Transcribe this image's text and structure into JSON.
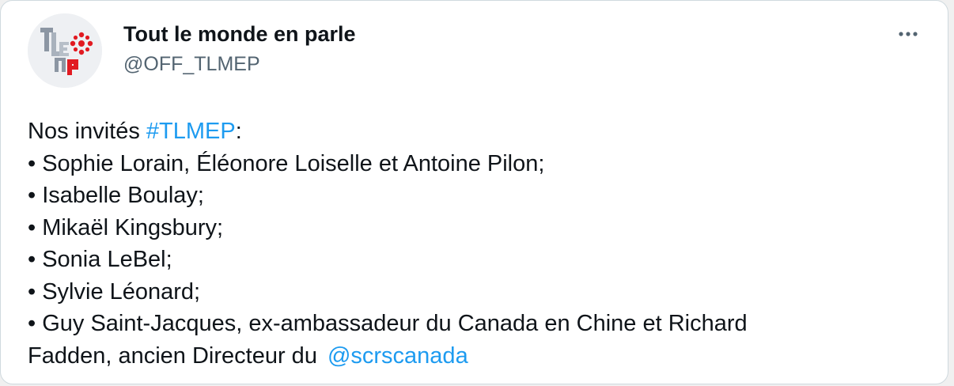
{
  "author": {
    "display_name": "Tout le monde en parle",
    "handle": "@OFF_TLMEP",
    "avatar_logo_text": "TLMEP",
    "avatar_icon": "radio-canada-gem-icon"
  },
  "menu": {
    "icon": "more-horizontal-icon"
  },
  "tweet": {
    "intro_text": "Nos invités ",
    "hashtag": "#TLMEP",
    "intro_suffix": ":",
    "guests": [
      "• Sophie Lorain, Éléonore Loiselle et Antoine Pilon;",
      "• Isabelle Boulay;",
      "• Mikaël Kingsbury;",
      "• Sonia LeBel;",
      "• Sylvie Léonard;",
      "• Guy Saint-Jacques, ex-ambassadeur du Canada en Chine et Richard"
    ],
    "last_line_text": "Fadden, ancien Directeur du",
    "mention": "@scrscanada"
  },
  "colors": {
    "link": "#1d9bf0",
    "text": "#0f1419",
    "secondary_text": "#536471",
    "brand_red": "#e11b22"
  }
}
